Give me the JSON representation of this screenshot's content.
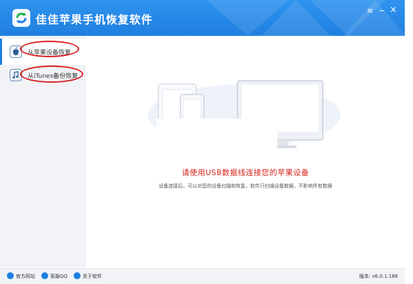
{
  "app": {
    "title": "佳佳苹果手机恢复软件",
    "controls": {
      "menu": "≡",
      "minimize": "−",
      "close": "×"
    }
  },
  "sidebar": {
    "items": [
      {
        "label": "从苹果设备恢复",
        "icon": "apple-icon",
        "active": true
      },
      {
        "label": "从iTunes备份恢复",
        "icon": "music-note-icon",
        "active": false
      }
    ]
  },
  "main": {
    "headline": "请使用USB数据线连接您的苹果设备",
    "subtext": "设备连接后，可以对您的设备扫描和恢复，软件只扫描设备数据，不影响所有数据"
  },
  "footer": {
    "links": [
      {
        "label": "官方网站",
        "icon": "home-icon"
      },
      {
        "label": "客服QQ",
        "icon": "qq-icon"
      },
      {
        "label": "关于软件",
        "icon": "info-icon"
      }
    ],
    "version": "版本: v6.0.1.188"
  },
  "colors": {
    "titlebar": "#1f7fe0",
    "accent": "#1f7fe0",
    "headline": "#d4231c",
    "annotation": "#d91e1e"
  }
}
